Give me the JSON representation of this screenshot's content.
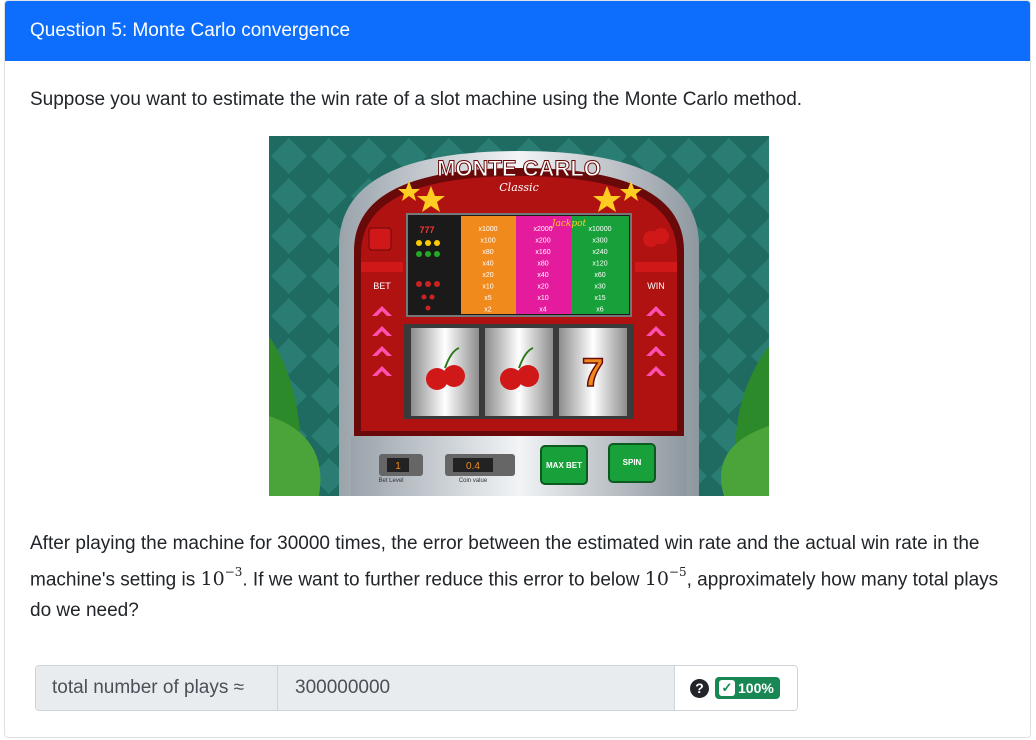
{
  "header": {
    "title": "Question 5: Monte Carlo convergence"
  },
  "question": {
    "intro": "Suppose you want to estimate the win rate of a slot machine using the Monte Carlo method.",
    "body_part1": "After playing the machine for 30000 times, the error between the estimated win rate and the actual win rate in the machine's setting is ",
    "err1_base": "10",
    "err1_exp": "−3",
    "body_part2": ". If we want to further reduce this error to below ",
    "err2_base": "10",
    "err2_exp": "−5",
    "body_part3": ", approximately how many total plays do we need?"
  },
  "slot_image": {
    "title": "MONTE CARLO",
    "subtitle": "Classic",
    "jackpot": "Jackpot",
    "bet_label": "BET",
    "win_label": "WIN",
    "col1": [
      "x1000",
      "x100",
      "x80",
      "x40",
      "x20",
      "x10",
      "x5",
      "x2"
    ],
    "col2": [
      "x2000",
      "x200",
      "x160",
      "x80",
      "x40",
      "x20",
      "x10",
      "x4"
    ],
    "col3": [
      "x10000",
      "x300",
      "x240",
      "x120",
      "x60",
      "x30",
      "x15",
      "x6"
    ],
    "bet_level_value": "1",
    "bet_level_label": "Bet Level",
    "coin_value": "0.4",
    "coin_label": "Coin value",
    "max_bet": "MAX BET",
    "spin": "SPIN",
    "colors": {
      "pink": "#e31b9c",
      "green": "#18a13a",
      "orange": "#f08a1c",
      "red": "#b01212"
    }
  },
  "answer": {
    "label": "total number of plays ≈",
    "value": "300000000",
    "help_icon": "?",
    "score_badge": "100%",
    "check_icon": "✓"
  }
}
